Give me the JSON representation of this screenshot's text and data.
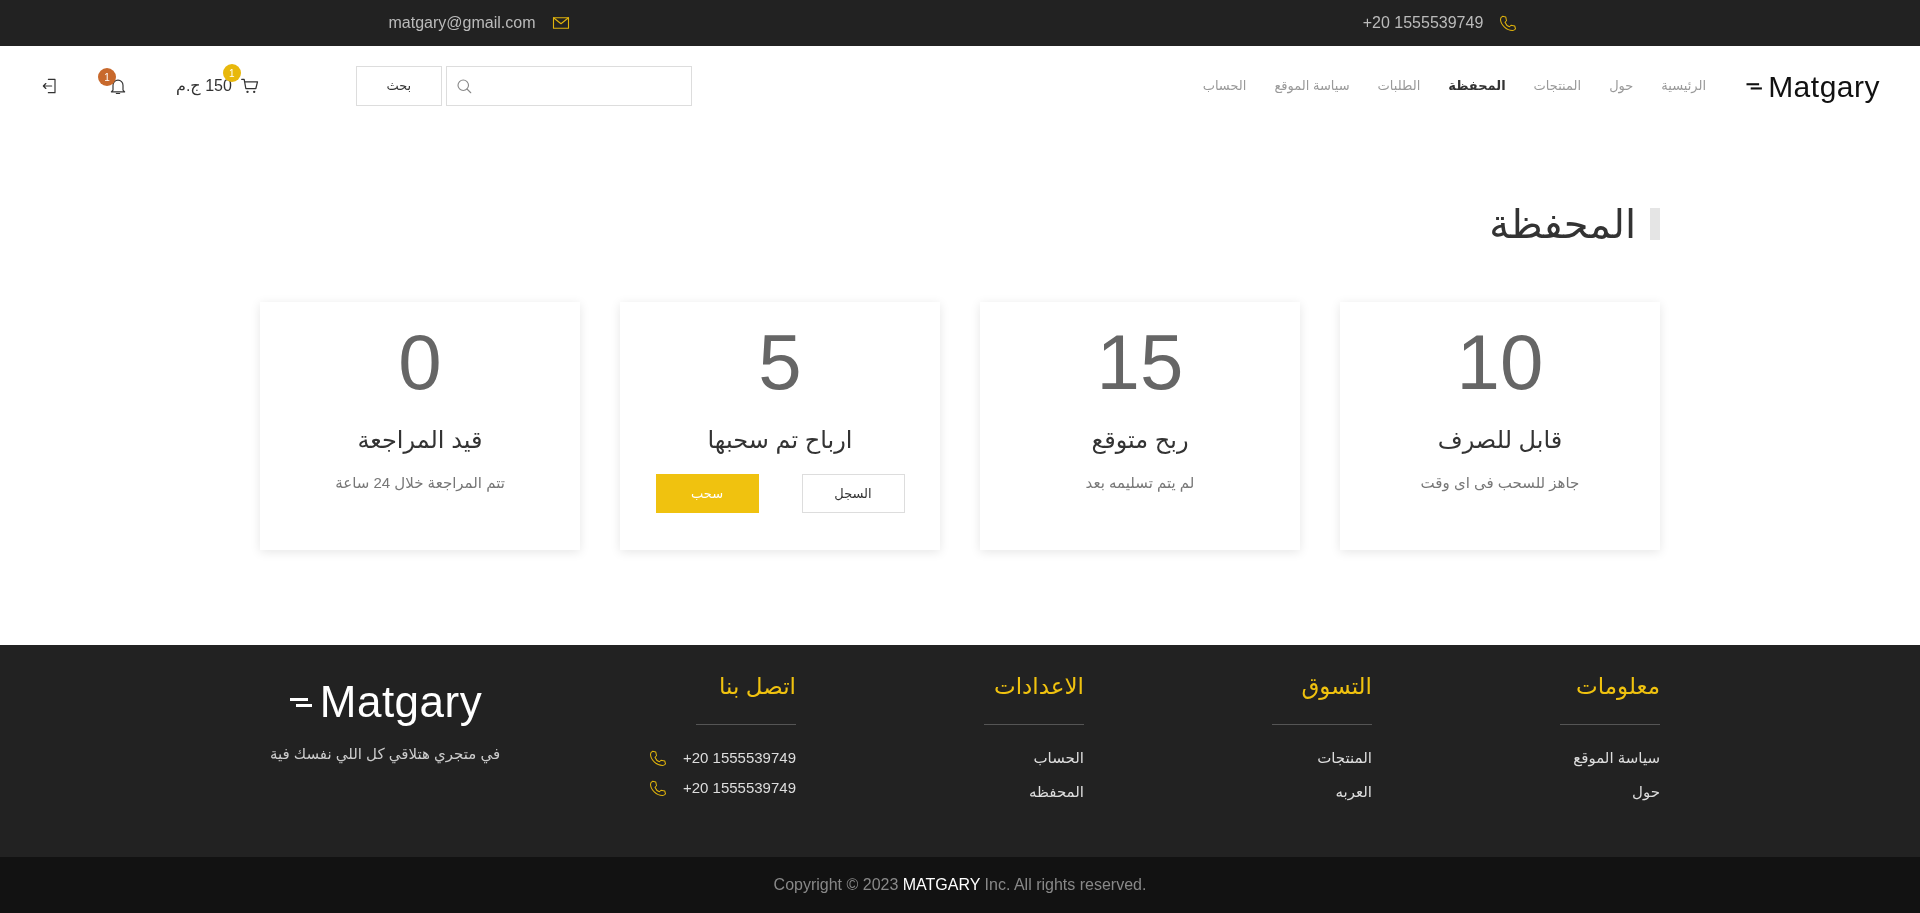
{
  "top_bar": {
    "email": "matgary@gmail.com",
    "phone": "+20 1555539749"
  },
  "navbar": {
    "logo": "Matgary",
    "links": [
      {
        "label": "الرئيسية",
        "selected": false
      },
      {
        "label": "حول",
        "selected": false
      },
      {
        "label": "المنتجات",
        "selected": false
      },
      {
        "label": "المحفظة",
        "selected": true
      },
      {
        "label": "الطلبات",
        "selected": false
      },
      {
        "label": "سياسة الموقع",
        "selected": false
      },
      {
        "label": "الحساب",
        "selected": false
      }
    ],
    "search": {
      "button": "بحث"
    },
    "cart": {
      "badge": "1",
      "total": "150 ج.م"
    },
    "notifications": {
      "badge": "1"
    }
  },
  "page_title": "المحفظة",
  "cards": [
    {
      "kind": "text",
      "value": "10",
      "title": "قابل للصرف",
      "subtitle": "جاهز للسحب فى اى وقت"
    },
    {
      "kind": "text",
      "value": "15",
      "title": "ربح متوقع",
      "subtitle": "لم يتم تسليمه بعد"
    },
    {
      "kind": "actions",
      "value": "5",
      "title": "ارباح تم سحبها",
      "buttons": [
        {
          "kind": "outline",
          "label": "السجل"
        },
        {
          "kind": "primary",
          "label": "سحب"
        }
      ]
    },
    {
      "kind": "text",
      "value": "0",
      "title": "قيد المراجعة",
      "subtitle": "تتم المراجعة خلال 24 ساعة"
    }
  ],
  "footer": {
    "columns": [
      {
        "heading": "معلومات",
        "links": [
          "سياسة الموقع",
          "حول"
        ]
      },
      {
        "heading": "التسوق",
        "links": [
          "المنتجات",
          "العربه"
        ]
      },
      {
        "heading": "الاعدادات",
        "links": [
          "الحساب",
          "المحفظه"
        ]
      }
    ],
    "contact": {
      "heading": "اتصل بنا",
      "phones": [
        "+20 1555539749",
        "+20 1555539749"
      ]
    },
    "brand": {
      "logo": "Matgary",
      "tagline": "في متجري هتلاقي كل اللي نفسك فية"
    },
    "copyright": "Copyright © 2023 **MATGARY** Inc. All rights reserved."
  }
}
